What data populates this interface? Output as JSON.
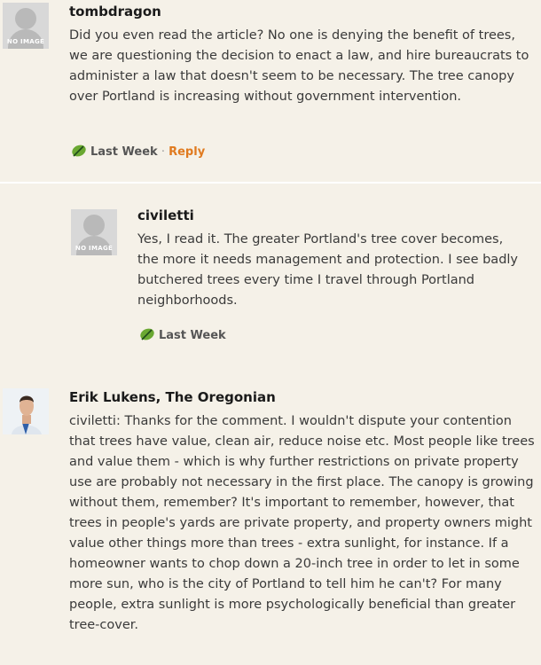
{
  "comments": [
    {
      "username": "tombdragon",
      "avatar_label": "NO IMAGE",
      "text": "Did you even read the article? No one is denying the benefit of trees, we are questioning the decision to enact a law, and hire bureaucrats to administer a law that doesn't seem to be necessary. The tree canopy over Portland is increasing without government intervention.",
      "timestamp": "Last Week",
      "separator": " · ",
      "reply_label": "Reply"
    },
    {
      "username": "civiletti",
      "avatar_label": "NO IMAGE",
      "text": "Yes, I read it. The greater Portland's tree cover becomes, the more it needs management and protection. I see badly butchered trees every time I travel through Portland neighborhoods.",
      "timestamp": "Last Week"
    },
    {
      "username": "Erik Lukens, The Oregonian",
      "text": "civiletti: Thanks for the comment. I wouldn't dispute your contention that trees have value, clean air, reduce noise etc. Most people like trees and value them - which is why further restrictions on private property use are probably not necessary in the first place. The canopy is growing without them, remember? It's important to remember, however, that trees in people's yards are private property, and property owners might value other things more than trees - extra sunlight, for instance. If a homeowner wants to chop down a 20-inch tree in order to let in some more sun, who is the city of Portland to tell him he can't? For many people, extra sunlight is more psychologically beneficial than greater tree-cover."
    }
  ],
  "icons": {
    "timestamp_icon": "leaf-icon"
  },
  "colors": {
    "reply": "#e07a1f",
    "background": "#f5f1e8",
    "leaf": "#6aa832"
  }
}
